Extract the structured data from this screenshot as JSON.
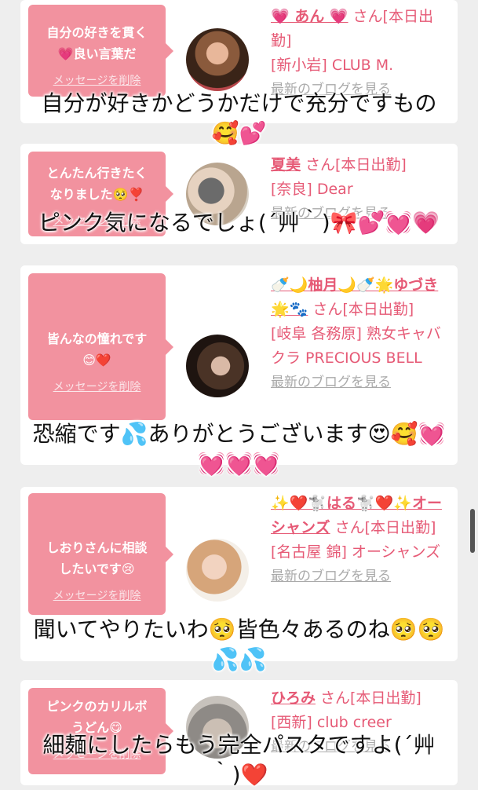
{
  "cards": [
    {
      "message": "自分の好きを貫く\n💗良い言葉だ",
      "delete_label": "メッセージを削除",
      "name": "💗 あん 💗",
      "suffix": "さん[本日出勤]",
      "location": "[新小岩] CLUB M.",
      "blog_label": "最新のブログを見る",
      "avatar": "woman-photo-avatar"
    },
    {
      "message": "とんたん行きたく\nなりました🥺❣️",
      "delete_label": "メッセージを削除",
      "name": "夏美",
      "suffix": "さん[本日出勤]",
      "location": "[奈良] Dear",
      "blog_label": "最新のブログを見る",
      "avatar": "woman-with-dog-avatar"
    },
    {
      "message": "皆んなの憧れです\n😊❤️",
      "delete_label": "メッセージを削除",
      "name": "🍼🌙柚月🌙🍼🌟ゆづき🌟🐾",
      "suffix": "さん[本日出勤]",
      "location": "[岐阜 各務原] 熟女キャバクラ PRECIOUS BELL",
      "blog_label": "最新のブログを見る",
      "avatar": "dark-hair-avatar"
    },
    {
      "message": "しおりさんに相談\nしたいです😢",
      "delete_label": "メッセージを削除",
      "name": "✨❤️🐩はる🐩❤️✨オーシャンズ",
      "suffix": "さん[本日出勤]",
      "location": "[名古屋 錦] オーシャンズ",
      "blog_label": "最新のブログを見る",
      "avatar": "blonde-woman-avatar"
    },
    {
      "message": "ピンクのカリルボ\nうどん😋",
      "delete_label": "メッセージを削除",
      "name": "ひろみ",
      "suffix": "さん[本日出勤]",
      "location": "[西新] club creer",
      "blog_label": "最新のブログを見る",
      "avatar": "hand-photo-avatar"
    }
  ],
  "overlays": [
    "自分が好きかどうかだけで充分ですもの\n🥰💕",
    "ピンク気になるでしょ(´艸｀)🎀💕💓💗",
    "恐縮です💦ありがとうございます😍🥰💓\n💓💓💓",
    "聞いてやりたいわ🥺皆色々あるのね🥺🥺\n💦💦",
    "細麺にしたらもう完全パスタですよ(´艸\n｀)❤️"
  ]
}
